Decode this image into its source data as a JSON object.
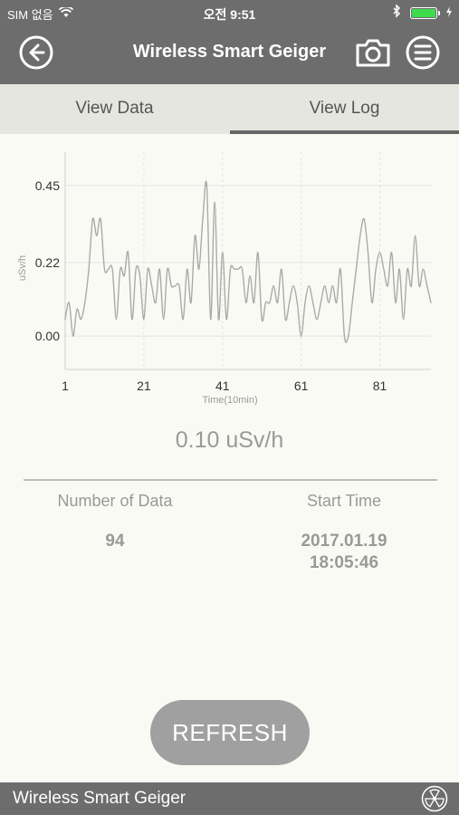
{
  "status_bar": {
    "carrier": "SIM 없음",
    "time": "오전 9:51",
    "icons": [
      "wifi-icon",
      "bluetooth-icon",
      "battery-icon"
    ]
  },
  "nav": {
    "title": "Wireless Smart Geiger",
    "back_icon": "back-arrow-icon",
    "camera_icon": "camera-icon",
    "menu_icon": "menu-icon"
  },
  "tabs": [
    {
      "label": "View Data",
      "active": false
    },
    {
      "label": "View Log",
      "active": true
    }
  ],
  "chart_data": {
    "type": "line",
    "title": "",
    "xlabel": "Time(10min)",
    "ylabel": "uSv/h",
    "x_ticks": [
      "1",
      "21",
      "41",
      "61",
      "81"
    ],
    "y_ticks": [
      "0.00",
      "0.22",
      "0.45"
    ],
    "xlim": [
      1,
      94
    ],
    "ylim": [
      -0.1,
      0.55
    ],
    "grid": true,
    "series": [
      {
        "color": "#aaaaaa",
        "x": [
          1,
          2,
          3,
          4,
          5,
          6,
          7,
          8,
          9,
          10,
          11,
          12,
          13,
          14,
          15,
          16,
          17,
          18,
          19,
          20,
          21,
          22,
          23,
          24,
          25,
          26,
          27,
          28,
          29,
          30,
          31,
          32,
          33,
          34,
          35,
          36,
          37,
          38,
          39,
          40,
          41,
          42,
          43,
          44,
          45,
          46,
          47,
          48,
          49,
          50,
          51,
          52,
          53,
          54,
          55,
          56,
          57,
          58,
          59,
          60,
          61,
          62,
          63,
          64,
          65,
          66,
          67,
          68,
          69,
          70,
          71,
          72,
          73,
          74,
          75,
          76,
          77,
          78,
          79,
          80,
          81,
          82,
          83,
          84,
          85,
          86,
          87,
          88,
          89,
          90,
          91,
          92,
          93,
          94
        ],
        "y": [
          0.05,
          0.1,
          0.0,
          0.08,
          0.05,
          0.1,
          0.2,
          0.35,
          0.3,
          0.35,
          0.2,
          0.2,
          0.2,
          0.05,
          0.2,
          0.18,
          0.25,
          0.05,
          0.2,
          0.18,
          0.05,
          0.2,
          0.15,
          0.1,
          0.2,
          0.05,
          0.2,
          0.15,
          0.15,
          0.15,
          0.05,
          0.2,
          0.1,
          0.3,
          0.2,
          0.35,
          0.45,
          0.05,
          0.4,
          0.05,
          0.25,
          0.05,
          0.2,
          0.2,
          0.2,
          0.2,
          0.1,
          0.18,
          0.1,
          0.25,
          0.05,
          0.1,
          0.1,
          0.15,
          0.1,
          0.2,
          0.05,
          0.1,
          0.15,
          0.1,
          0.0,
          0.1,
          0.15,
          0.1,
          0.05,
          0.1,
          0.15,
          0.1,
          0.15,
          0.1,
          0.2,
          0.0,
          0.0,
          0.1,
          0.2,
          0.3,
          0.35,
          0.25,
          0.1,
          0.2,
          0.25,
          0.2,
          0.15,
          0.25,
          0.1,
          0.2,
          0.05,
          0.2,
          0.15,
          0.3,
          0.15,
          0.2,
          0.15,
          0.1
        ]
      }
    ]
  },
  "current_value": "0.10 uSv/h",
  "info": {
    "count_label": "Number of Data",
    "count_value": "94",
    "start_label": "Start Time",
    "start_date": "2017.01.19",
    "start_time": "18:05:46"
  },
  "refresh_label": "REFRESH",
  "footer": {
    "title": "Wireless Smart Geiger",
    "logo_icon": "radiation-icon"
  }
}
